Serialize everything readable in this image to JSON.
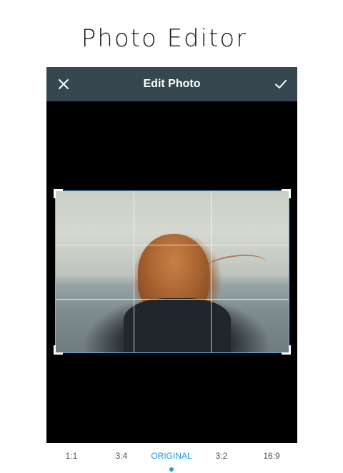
{
  "promo": {
    "title": "Photo Editor"
  },
  "toolbar": {
    "title": "Edit Photo",
    "close_icon": "close-icon",
    "confirm_icon": "check-icon"
  },
  "aspect_ratios": {
    "options": [
      "1:1",
      "3:4",
      "ORIGINAL",
      "3:2",
      "16:9"
    ],
    "selected": "ORIGINAL"
  },
  "colors": {
    "toolbar_bg": "#37474f",
    "accent": "#2196f3",
    "canvas_bg": "#000000"
  }
}
